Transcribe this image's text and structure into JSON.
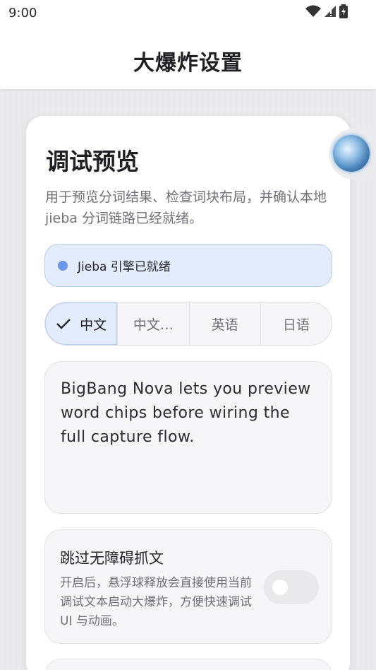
{
  "status_bar": {
    "time": "9:00",
    "icons": [
      "wifi-icon",
      "signal-icon",
      "battery-icon"
    ]
  },
  "app_bar": {
    "title": "大爆炸设置"
  },
  "card": {
    "title": "调试预览",
    "description": "用于预览分词结果、检查词块布局，并确认本地 jieba 分词链路已经就绪。",
    "engine_status": "Jieba 引擎已就绪",
    "language_tabs": [
      {
        "label": "中文",
        "selected": true
      },
      {
        "label": "中文…",
        "selected": false
      },
      {
        "label": "英语",
        "selected": false
      },
      {
        "label": "日语",
        "selected": false
      }
    ],
    "preview_text": "BigBang Nova lets you preview word chips before wiring the full capture flow.",
    "skip_setting": {
      "title": "跳过无障碍抓文",
      "description": "开启后，悬浮球释放会直接使用当前调试文本启动大爆炸，方便快速调试 UI 与动画。",
      "enabled": false
    }
  },
  "colors": {
    "accent_bg": "#e3ecfd",
    "accent_border": "#b6cdf3",
    "accent_dot": "#6c96ec"
  }
}
